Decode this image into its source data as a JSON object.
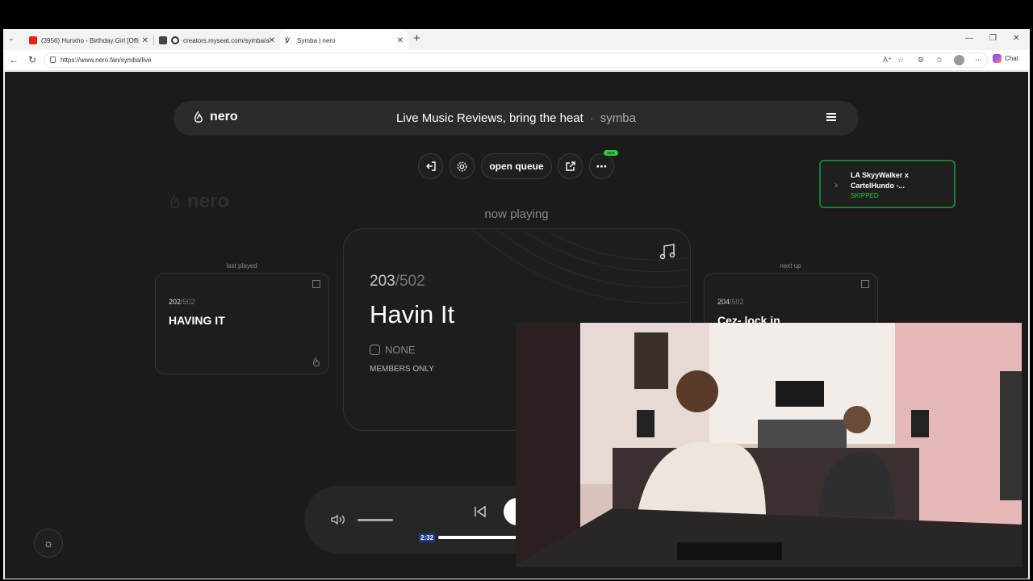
{
  "browser": {
    "tabs": [
      {
        "label": "(3956) Hunxho - Birthday Girl [Offi",
        "favicon": "youtube-icon",
        "active": false
      },
      {
        "label": "creators.myseat.com/symba/a",
        "favicon": "site-icon",
        "active": false
      },
      {
        "label": "Symba | nero",
        "favicon": "nero-icon",
        "active": true
      }
    ],
    "url": "https://www.nero.fan/symba/live",
    "chat_label": "Chat"
  },
  "header": {
    "brand": "nero",
    "title": "Live Music Reviews, bring the heat",
    "separator": "·",
    "user": "symba"
  },
  "controls": {
    "open_queue": "open queue",
    "new_badge": "NEW"
  },
  "toast": {
    "title": "LA SkyyWalker x CartelHundo -...",
    "status": "SKIPPED"
  },
  "ghost_logo": "nero",
  "now_playing": {
    "label": "now playing",
    "position": "203",
    "total": "/502",
    "title": "Havin It",
    "instagram": "NONE",
    "access": "MEMBERS ONLY"
  },
  "last_played": {
    "label": "last played",
    "position": "202",
    "total": "/502",
    "title": "HAVING IT"
  },
  "next_up": {
    "label": "next up",
    "position": "204",
    "total": "/502",
    "title": "Cez- lock in"
  },
  "player": {
    "current_time": "2:32"
  },
  "colors": {
    "accent_green": "#2ecc40",
    "background": "#1b1b1b"
  }
}
